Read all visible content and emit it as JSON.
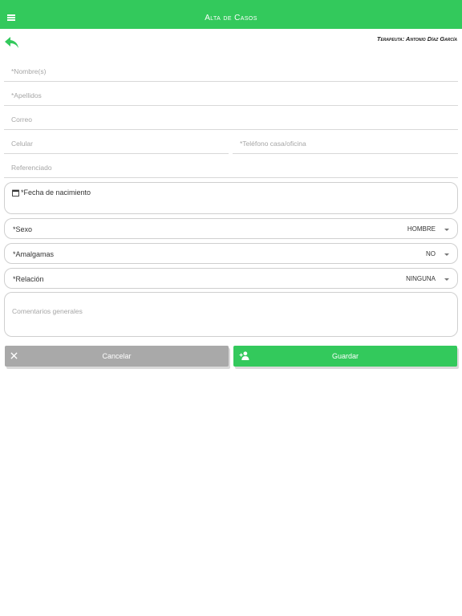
{
  "header": {
    "title": "Alta de Casos",
    "menu_icon": "hamburger-menu-icon",
    "accent_color": "#33c95c"
  },
  "therapist_label": "Terapeuta: Antonio Díaz García",
  "form": {
    "nombre_placeholder": "*Nombre(s)",
    "apellidos_placeholder": "*Apellidos",
    "correo_placeholder": "Correo",
    "celular_placeholder": "Celular",
    "telefono_placeholder": "*Teléfono casa/oficina",
    "referenciado_placeholder": "Referenciado",
    "fecha_label": "*Fecha de nacimiento",
    "sexo": {
      "label": "*Sexo",
      "value": "HOMBRE"
    },
    "amalgamas": {
      "label": "*Amalgamas",
      "value": "NO"
    },
    "relacion": {
      "label": "*Relación",
      "value": "NINGUNA"
    },
    "comentarios_placeholder": "Comentarios generales"
  },
  "buttons": {
    "cancel_label": "Cancelar",
    "cancel_color": "#a9a9a9",
    "save_label": "Guardar",
    "save_color": "#33c95c"
  }
}
